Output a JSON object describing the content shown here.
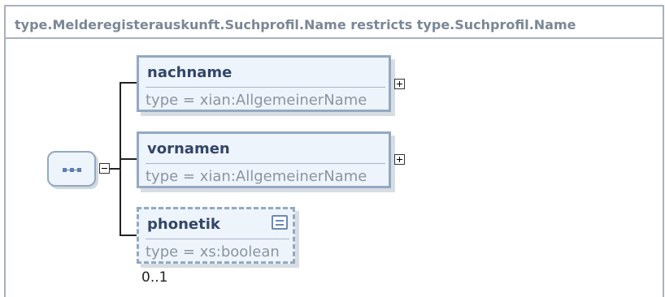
{
  "diagram": {
    "title": "type.Melderegisterauskunft.Suchprofil.Name restricts type.Suchprofil.Name",
    "compositor": "sequence",
    "elements": [
      {
        "name": "nachname",
        "type": "type = xian:AllgemeinerName",
        "expandable": true
      },
      {
        "name": "vornamen",
        "type": "type = xian:AllgemeinerName",
        "expandable": true
      },
      {
        "name": "phonetik",
        "type": "type = xs:boolean",
        "documented": true,
        "occurrence": "0..1"
      }
    ]
  }
}
